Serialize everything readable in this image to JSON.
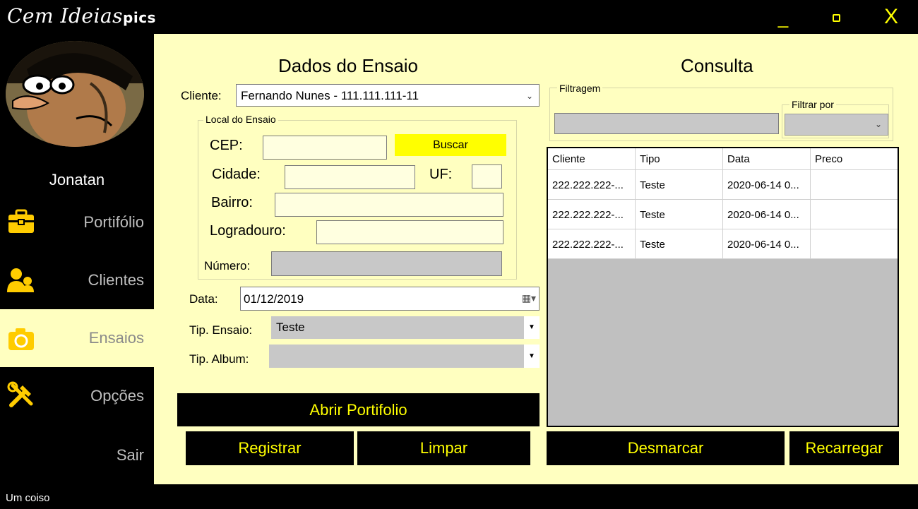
{
  "app": {
    "logo_script": "Cem Ideias",
    "logo_suffix": "pics",
    "minimize": "_",
    "close": "X"
  },
  "sidebar": {
    "username": "Jonatan",
    "items": [
      {
        "label": "Portifólio",
        "icon": "briefcase-icon"
      },
      {
        "label": "Clientes",
        "icon": "users-icon"
      },
      {
        "label": "Ensaios",
        "icon": "camera-icon",
        "active": true
      },
      {
        "label": "Opções",
        "icon": "tools-icon"
      },
      {
        "label": "Sair"
      }
    ]
  },
  "form": {
    "title": "Dados do Ensaio",
    "cliente_label": "Cliente:",
    "cliente_value": "Fernando Nunes - 111.111.111-11",
    "local_group": "Local do Ensaio",
    "cep_label": "CEP:",
    "cep_value": "",
    "buscar": "Buscar",
    "cidade_label": "Cidade:",
    "uf_label": "UF:",
    "bairro_label": "Bairro:",
    "logradouro_label": "Logradouro:",
    "numero_label": "Número:",
    "data_label": "Data:",
    "data_value": "01/12/2019",
    "tip_ensaio_label": "Tip. Ensaio:",
    "tip_ensaio_value": "Teste",
    "tip_album_label": "Tip. Album:",
    "tip_album_value": "",
    "abrir_portifolio": "Abrir Portifolio",
    "registrar": "Registrar",
    "limpar": "Limpar"
  },
  "consulta": {
    "title": "Consulta",
    "filtragem_label": "Filtragem",
    "filtrar_por_label": "Filtrar por",
    "columns": [
      "Cliente",
      "Tipo",
      "Data",
      "Preco"
    ],
    "rows": [
      [
        "222.222.222-...",
        "Teste",
        "2020-06-14 0...",
        ""
      ],
      [
        "222.222.222-...",
        "Teste",
        "2020-06-14 0...",
        ""
      ],
      [
        "222.222.222-...",
        "Teste",
        "2020-06-14 0...",
        ""
      ]
    ],
    "desmarcar": "Desmarcar",
    "recarregar": "Recarregar"
  },
  "status": {
    "text": "Um coiso"
  },
  "colors": {
    "accent": "#ffff00",
    "panel": "#ffffc0",
    "sidebar": "#000000",
    "input": "#ffffe0"
  }
}
